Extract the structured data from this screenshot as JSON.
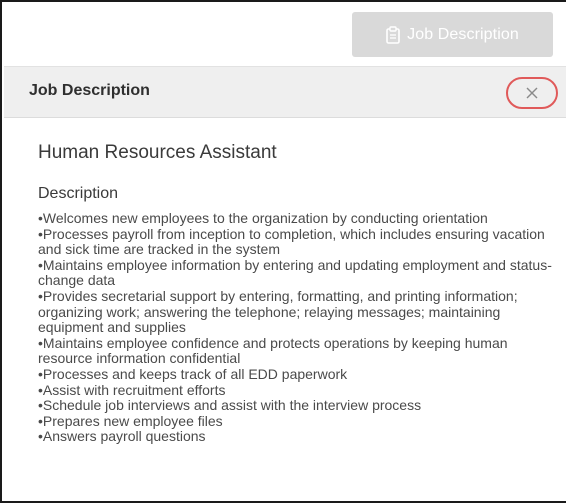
{
  "toolbar": {
    "job_description_button_label": "Job Description",
    "button_icon": "clipboard-icon"
  },
  "panel": {
    "title": "Job Description",
    "close_icon": "close-icon"
  },
  "content": {
    "job_title": "Human Resources Assistant",
    "section_title": "Description",
    "bullets": [
      "•Welcomes new employees to the organization by conducting orientation",
      "•Processes payroll from inception to completion, which includes ensuring vacation and sick time are tracked in the system",
      "•Maintains employee information by entering and updating employment and status-change data",
      "•Provides secretarial support by entering, formatting, and printing information; organizing work; answering the telephone; relaying messages; maintaining equipment and supplies",
      "•Maintains employee confidence and protects operations by keeping human resource information confidential",
      "•Processes and keeps track of all EDD paperwork",
      "•Assist with recruitment efforts",
      "•Schedule job interviews and assist with the interview process",
      "•Prepares new employee files",
      "•Answers payroll questions"
    ]
  },
  "colors": {
    "button_bg": "#d9d9d9",
    "header_bg": "#efefef",
    "close_highlight": "#e05a5a"
  }
}
